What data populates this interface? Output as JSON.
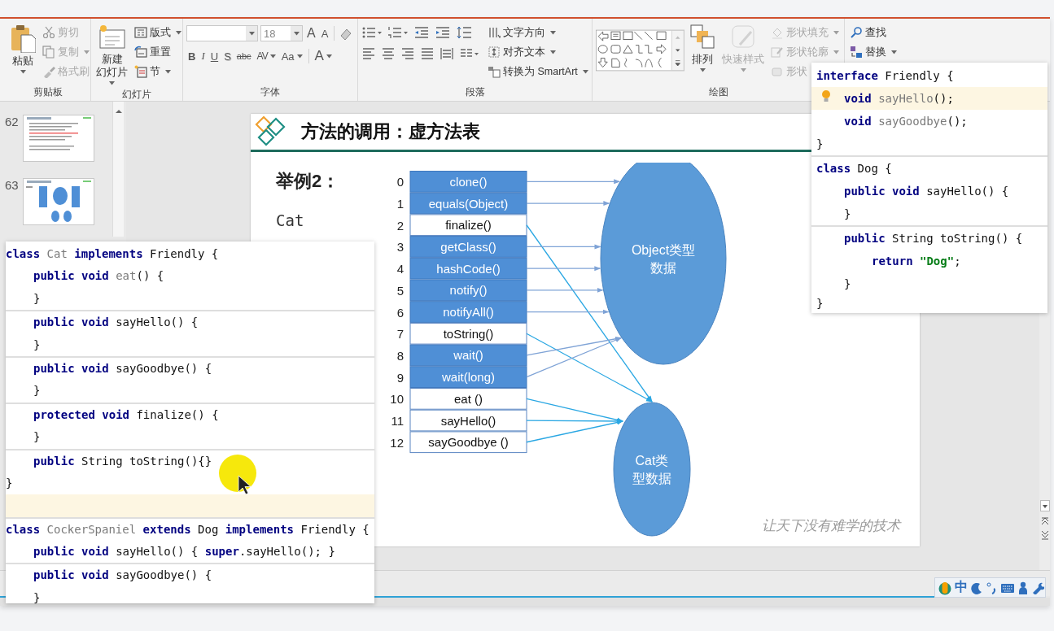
{
  "ribbon": {
    "groups": [
      {
        "label": "剪贴板",
        "kind": "plain",
        "items": [
          {
            "kind": "large",
            "label": "粘贴",
            "dropdown": true,
            "disabled": false
          },
          {
            "kind": "small",
            "label": "剪切",
            "dropdown": false,
            "disabled": true
          },
          {
            "kind": "small",
            "label": "复制",
            "dropdown": true,
            "disabled": true
          },
          {
            "kind": "small",
            "label": "格式刷",
            "dropdown": false,
            "disabled": true
          }
        ]
      },
      {
        "label": "幻灯片",
        "kind": "plain",
        "items": [
          {
            "kind": "large",
            "label_lines": [
              "新建",
              "幻灯片"
            ],
            "dropdown": true,
            "disabled": false
          },
          {
            "kind": "small",
            "label": "版式",
            "dropdown": true,
            "disabled": false
          },
          {
            "kind": "small",
            "label": "重置",
            "dropdown": false,
            "disabled": false
          },
          {
            "kind": "small",
            "label": "节",
            "dropdown": true,
            "disabled": false
          }
        ]
      },
      {
        "label": "字体",
        "kind": "font",
        "font_size": "18",
        "size_buttons": [
          "A",
          "A"
        ],
        "glyphs": [
          "B",
          "I",
          "U",
          "S",
          "abc",
          "AV",
          "Aa",
          "A"
        ]
      },
      {
        "label": "段落",
        "kind": "paragraph",
        "items": [
          {
            "kind": "small",
            "label": "文字方向",
            "dropdown": true,
            "disabled": false
          },
          {
            "kind": "small",
            "label": "对齐文本",
            "dropdown": true,
            "disabled": false
          },
          {
            "kind": "small",
            "label": "转换为 SmartArt",
            "dropdown": true,
            "disabled": false
          }
        ]
      },
      {
        "label": "绘图",
        "kind": "drawing",
        "items": [
          {
            "kind": "large",
            "label": "排列",
            "dropdown": true,
            "disabled": false
          },
          {
            "kind": "large",
            "label": "快速样式",
            "dropdown": true,
            "disabled": true
          },
          {
            "kind": "small",
            "label": "形状填充",
            "dropdown": true,
            "disabled": true
          },
          {
            "kind": "small",
            "label": "形状轮廓",
            "dropdown": true,
            "disabled": true
          },
          {
            "kind": "small",
            "label": "形状",
            "dropdown": false,
            "disabled": true
          }
        ]
      },
      {
        "kind": "plain",
        "items": [
          {
            "kind": "small",
            "label": "查找",
            "dropdown": false,
            "disabled": false
          },
          {
            "kind": "small",
            "label": "替换",
            "dropdown": true,
            "disabled": false
          }
        ]
      }
    ]
  },
  "thumbnails": [
    {
      "number": "62",
      "kind": "text"
    },
    {
      "number": "63",
      "kind": "diagram"
    }
  ],
  "slide": {
    "title": "方法的调用：虚方法表",
    "example": "举例2：",
    "class_label": "Cat",
    "watermark": "让天下没有难学的技术"
  },
  "diagram": {
    "methods": [
      {
        "index": "0",
        "name": "clone()",
        "inherited": true,
        "kind": "object"
      },
      {
        "index": "1",
        "name": "equals(Object)",
        "inherited": true,
        "kind": "object"
      },
      {
        "index": "2",
        "name": "finalize()",
        "inherited": false,
        "kind": "cat"
      },
      {
        "index": "3",
        "name": "getClass()",
        "inherited": true,
        "kind": "object"
      },
      {
        "index": "4",
        "name": "hashCode()",
        "inherited": true,
        "kind": "object"
      },
      {
        "index": "5",
        "name": "notify()",
        "inherited": true,
        "kind": "object"
      },
      {
        "index": "6",
        "name": "notifyAll()",
        "inherited": true,
        "kind": "object"
      },
      {
        "index": "7",
        "name": "toString()",
        "inherited": false,
        "kind": "cat"
      },
      {
        "index": "8",
        "name": "wait()",
        "inherited": true,
        "kind": "object"
      },
      {
        "index": "9",
        "name": "wait(long)",
        "inherited": true,
        "kind": "object"
      },
      {
        "index": "10",
        "name": "eat ()",
        "inherited": false,
        "kind": "cat"
      },
      {
        "index": "11",
        "name": "sayHello()",
        "inherited": false,
        "kind": "cat"
      },
      {
        "index": "12",
        "name": "sayGoodbye ()",
        "inherited": false,
        "kind": "cat"
      }
    ],
    "regions": [
      {
        "kind": "object",
        "lines": [
          "Object类型",
          "数据"
        ]
      },
      {
        "kind": "cat",
        "lines": [
          "Cat类",
          "型数据"
        ]
      }
    ]
  },
  "code_left": {
    "bulb": false,
    "blocks": [
      {
        "lines": [
          {
            "kind": "top",
            "current": false,
            "tokens": [
              {
                "kind": "kw",
                "text": "class "
              },
              {
                "kind": "dim",
                "text": "Cat "
              },
              {
                "kind": "kw",
                "text": "implements "
              },
              {
                "kind": "pl",
                "text": "Friendly {"
              }
            ]
          },
          {
            "kind": "member",
            "current": false,
            "tokens": [
              {
                "kind": "kw",
                "text": "public void "
              },
              {
                "kind": "dim",
                "text": "eat"
              },
              {
                "kind": "pl",
                "text": "() {"
              }
            ]
          },
          {
            "kind": "member",
            "current": false,
            "tokens": [
              {
                "kind": "pl",
                "text": "}"
              }
            ]
          }
        ]
      },
      {
        "lines": [
          {
            "kind": "member",
            "current": false,
            "tokens": [
              {
                "kind": "kw",
                "text": "public void "
              },
              {
                "kind": "pl",
                "text": "sayHello() {"
              }
            ]
          },
          {
            "kind": "member",
            "current": false,
            "tokens": [
              {
                "kind": "pl",
                "text": "}"
              }
            ]
          }
        ]
      },
      {
        "lines": [
          {
            "kind": "member",
            "current": false,
            "tokens": [
              {
                "kind": "kw",
                "text": "public void "
              },
              {
                "kind": "pl",
                "text": "sayGoodbye() {"
              }
            ]
          },
          {
            "kind": "member",
            "current": false,
            "tokens": [
              {
                "kind": "pl",
                "text": "}"
              }
            ]
          }
        ]
      },
      {
        "lines": [
          {
            "kind": "member",
            "current": false,
            "tokens": [
              {
                "kind": "kw",
                "text": "protected void "
              },
              {
                "kind": "pl",
                "text": "finalize() {"
              }
            ]
          },
          {
            "kind": "member",
            "current": false,
            "tokens": [
              {
                "kind": "pl",
                "text": "}"
              }
            ]
          }
        ]
      },
      {
        "lines": [
          {
            "kind": "member",
            "current": false,
            "tokens": [
              {
                "kind": "kw",
                "text": "public "
              },
              {
                "kind": "pl",
                "text": "String toString(){}"
              }
            ]
          },
          {
            "kind": "top",
            "current": false,
            "tokens": [
              {
                "kind": "pl",
                "text": "}"
              }
            ]
          },
          {
            "kind": "top",
            "current": true
          }
        ]
      },
      {
        "lines": [
          {
            "kind": "top",
            "current": false,
            "tokens": [
              {
                "kind": "kw",
                "text": "class "
              },
              {
                "kind": "dim",
                "text": "CockerSpaniel "
              },
              {
                "kind": "kw",
                "text": "extends "
              },
              {
                "kind": "pl",
                "text": "Dog "
              },
              {
                "kind": "kw",
                "text": "implements "
              },
              {
                "kind": "pl",
                "text": "Friendly {"
              }
            ]
          },
          {
            "kind": "member",
            "current": false,
            "tokens": [
              {
                "kind": "kw",
                "text": "public void "
              },
              {
                "kind": "pl",
                "text": "sayHello() { "
              },
              {
                "kind": "kw",
                "text": "super"
              },
              {
                "kind": "pl",
                "text": ".sayHello(); }"
              }
            ]
          }
        ]
      },
      {
        "lines": [
          {
            "kind": "member",
            "current": false,
            "tokens": [
              {
                "kind": "kw",
                "text": "public void "
              },
              {
                "kind": "pl",
                "text": "sayGoodbye() {"
              }
            ]
          },
          {
            "kind": "member",
            "current": false,
            "tokens": [
              {
                "kind": "pl",
                "text": "}"
              }
            ]
          }
        ]
      }
    ]
  },
  "code_right": {
    "bulb": true,
    "blocks": [
      {
        "lines": [
          {
            "kind": "top",
            "current": false,
            "tokens": [
              {
                "kind": "kw",
                "text": "interface "
              },
              {
                "kind": "pl",
                "text": "Friendly {"
              }
            ]
          },
          {
            "kind": "member",
            "current": true,
            "tokens": [
              {
                "kind": "kw",
                "text": "void "
              },
              {
                "kind": "dim",
                "text": "sayHello"
              },
              {
                "kind": "pl",
                "text": "();"
              }
            ]
          },
          {
            "kind": "member",
            "current": false,
            "tokens": [
              {
                "kind": "kw",
                "text": "void "
              },
              {
                "kind": "dim",
                "text": "sayGoodbye"
              },
              {
                "kind": "pl",
                "text": "();"
              }
            ]
          },
          {
            "kind": "top",
            "current": false,
            "tokens": [
              {
                "kind": "pl",
                "text": "}"
              }
            ]
          }
        ]
      },
      {
        "lines": [
          {
            "kind": "top",
            "current": false,
            "tokens": [
              {
                "kind": "kw",
                "text": "class "
              },
              {
                "kind": "pl",
                "text": "Dog {"
              }
            ]
          },
          {
            "kind": "member",
            "current": false,
            "tokens": [
              {
                "kind": "kw",
                "text": "public void "
              },
              {
                "kind": "pl",
                "text": "sayHello() {"
              }
            ]
          },
          {
            "kind": "member",
            "current": false,
            "tokens": [
              {
                "kind": "pl",
                "text": "}"
              }
            ]
          }
        ]
      },
      {
        "lines": [
          {
            "kind": "member",
            "current": false,
            "tokens": [
              {
                "kind": "kw",
                "text": "public "
              },
              {
                "kind": "pl",
                "text": "String toString() {"
              }
            ]
          },
          {
            "kind": "body",
            "current": false,
            "tokens": [
              {
                "kind": "kw",
                "text": "return "
              },
              {
                "kind": "str",
                "text": "\"Dog\""
              },
              {
                "kind": "pl",
                "text": ";"
              }
            ]
          },
          {
            "kind": "member",
            "current": false,
            "tokens": [
              {
                "kind": "pl",
                "text": "}"
              }
            ]
          },
          {
            "kind": "top",
            "current": false,
            "tokens": [
              {
                "kind": "pl",
                "text": "}"
              }
            ]
          }
        ]
      }
    ]
  },
  "ime_bar": {
    "mode": "中"
  }
}
